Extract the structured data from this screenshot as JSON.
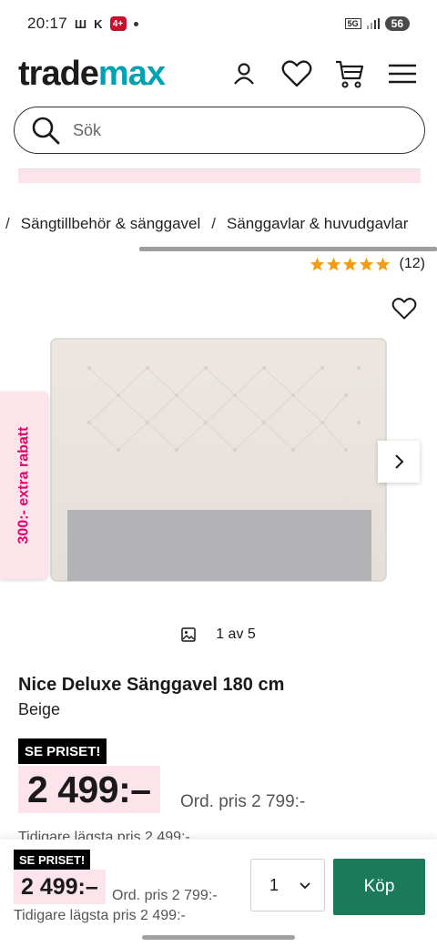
{
  "status_bar": {
    "time": "20:17",
    "notif_w": "Ш",
    "notif_k": "K",
    "notif_badge": "4+",
    "network": "5G",
    "battery": "56"
  },
  "header": {
    "logo_part1": "trade",
    "logo_part2": "max",
    "brand_color": "#00a1b4"
  },
  "search": {
    "placeholder": "Sök"
  },
  "breadcrumb": {
    "items": [
      "Sängtillbehör & sänggavel",
      "Sänggavlar & huvudgavlar"
    ]
  },
  "rating": {
    "stars": 5,
    "count": "(12)",
    "star_color": "#f39c12"
  },
  "gallery": {
    "side_tab": "300:- extra rabatt",
    "counter": "1 av 5",
    "current": 1,
    "total": 5
  },
  "product": {
    "title": "Nice Deluxe Sänggavel 180 cm",
    "color": "Beige",
    "badge": "SE PRISET!",
    "price": "2 499:–",
    "ord_price": "Ord. pris 2 799:-",
    "previous_lowest": "Tidigare lägsta pris 2 499:-"
  },
  "sticky": {
    "badge": "SE PRISET!",
    "price": "2 499:–",
    "ord_price": "Ord. pris 2 799:-",
    "previous_lowest": "Tidigare lägsta pris 2 499:-",
    "quantity": "1",
    "buy_label": "Köp",
    "buy_color": "#1a7a5a"
  }
}
